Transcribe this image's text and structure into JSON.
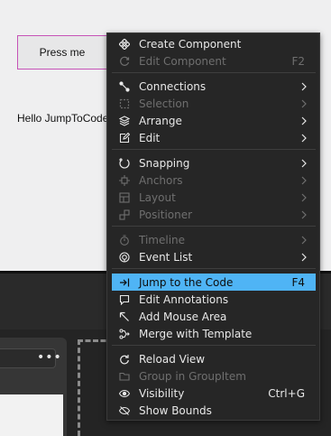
{
  "canvas": {
    "button_label": "Press me",
    "text": "Hello JumpToCode"
  },
  "toolbar": {
    "more_label": "•••"
  },
  "menu": {
    "items": [
      {
        "label": "Create Component",
        "icon": "component-icon",
        "enabled": true,
        "shortcut": "",
        "submenu": false
      },
      {
        "label": "Edit Component",
        "icon": "edit-component-icon",
        "enabled": false,
        "shortcut": "F2",
        "submenu": false
      },
      {
        "label": "Connections",
        "icon": "connections-icon",
        "enabled": true,
        "shortcut": "",
        "submenu": true
      },
      {
        "label": "Selection",
        "icon": "selection-icon",
        "enabled": false,
        "shortcut": "",
        "submenu": true
      },
      {
        "label": "Arrange",
        "icon": "arrange-icon",
        "enabled": true,
        "shortcut": "",
        "submenu": true
      },
      {
        "label": "Edit",
        "icon": "edit-icon",
        "enabled": true,
        "shortcut": "",
        "submenu": true
      },
      {
        "label": "Snapping",
        "icon": "snapping-icon",
        "enabled": true,
        "shortcut": "",
        "submenu": true
      },
      {
        "label": "Anchors",
        "icon": "anchors-icon",
        "enabled": false,
        "shortcut": "",
        "submenu": true
      },
      {
        "label": "Layout",
        "icon": "layout-icon",
        "enabled": false,
        "shortcut": "",
        "submenu": true
      },
      {
        "label": "Positioner",
        "icon": "positioner-icon",
        "enabled": false,
        "shortcut": "",
        "submenu": true
      },
      {
        "label": "Timeline",
        "icon": "timeline-icon",
        "enabled": false,
        "shortcut": "",
        "submenu": true
      },
      {
        "label": "Event List",
        "icon": "event-list-icon",
        "enabled": true,
        "shortcut": "",
        "submenu": true
      },
      {
        "label": "Jump to the Code",
        "icon": "jump-to-code-icon",
        "enabled": true,
        "shortcut": "F4",
        "submenu": false,
        "highlighted": true
      },
      {
        "label": "Edit Annotations",
        "icon": "annotation-icon",
        "enabled": true,
        "shortcut": "",
        "submenu": false
      },
      {
        "label": "Add Mouse Area",
        "icon": "mouse-area-icon",
        "enabled": true,
        "shortcut": "",
        "submenu": false
      },
      {
        "label": "Merge with Template",
        "icon": "merge-icon",
        "enabled": true,
        "shortcut": "",
        "submenu": false
      },
      {
        "label": "Reload View",
        "icon": "reload-icon",
        "enabled": true,
        "shortcut": "",
        "submenu": false
      },
      {
        "label": "Group in GroupItem",
        "icon": "group-icon",
        "enabled": false,
        "shortcut": "",
        "submenu": false
      },
      {
        "label": "Visibility",
        "icon": "visibility-icon",
        "enabled": true,
        "shortcut": "Ctrl+G",
        "submenu": false
      },
      {
        "label": "Show Bounds",
        "icon": "show-bounds-icon",
        "enabled": true,
        "shortcut": "",
        "submenu": false
      }
    ],
    "highlight_color": "#4fb4f5"
  }
}
